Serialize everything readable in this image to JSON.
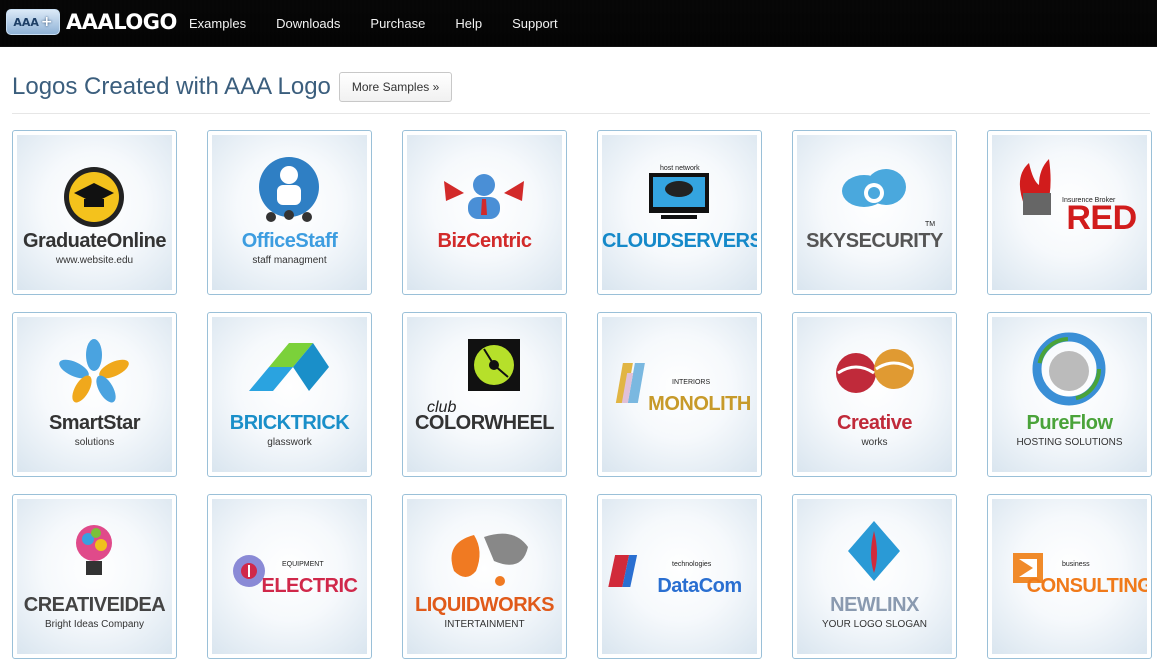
{
  "brand": {
    "badge": "AAA",
    "plus": "+",
    "name": "AAALOGO"
  },
  "nav": {
    "items": [
      "Examples",
      "Downloads",
      "Purchase",
      "Help",
      "Support"
    ]
  },
  "heading": {
    "title": "Logos Created with AAA Logo",
    "more_button": "More Samples »"
  },
  "logos": [
    {
      "name": "GraduateOnline",
      "sub": "www.website.edu",
      "tag": "",
      "color": "#333333",
      "accent": "#f4c21c",
      "icon": "graduation-cap-icon"
    },
    {
      "name": "OfficeStaff",
      "sub": "staff managment",
      "tag": "",
      "color": "#3d9de0",
      "accent": "#2f7fc4",
      "icon": "people-icon"
    },
    {
      "name": "BizCentric",
      "sub": "",
      "tag": "",
      "color": "#d22a2a",
      "accent": "#4a8fd6",
      "icon": "person-arrows-icon"
    },
    {
      "name": "CLOUDSERVERS",
      "sub": "",
      "tag": "host network",
      "color": "#1589c9",
      "accent": "#34a4e0",
      "icon": "monitor-cloud-icon"
    },
    {
      "name": "SKYSECURITY",
      "sub": "",
      "tag": "TM",
      "color": "#555555",
      "accent": "#4aa8dd",
      "icon": "cloud-lock-icon"
    },
    {
      "name": "RED",
      "sub": "",
      "tag": "Insurence Broker",
      "color": "#d11c1c",
      "accent": "#e64a1e",
      "icon": "flame-icon"
    },
    {
      "name": "SmartStar",
      "sub": "solutions",
      "tag": "",
      "color": "#333333",
      "accent": "#4aa3e0",
      "icon": "star-drops-icon"
    },
    {
      "name": "BRICKTRICK",
      "sub": "glasswork",
      "tag": "",
      "color": "#1a8fc9",
      "accent": "#7bd13a",
      "icon": "bricks-icon"
    },
    {
      "name": "COLORWHEEL",
      "sub": "",
      "tag": "club",
      "color": "#333333",
      "accent": "#b6e02a",
      "icon": "colorwheel-icon"
    },
    {
      "name": "MONOLITH",
      "sub": "",
      "tag": "INTERIORS",
      "color": "#c79a2a",
      "accent": "#e1b543",
      "icon": "monolith-icon"
    },
    {
      "name": "Creative",
      "sub": "works",
      "tag": "",
      "color": "#c02a3a",
      "accent": "#e09a32",
      "icon": "spheres-icon"
    },
    {
      "name": "PureFlow",
      "sub": "HOSTING SOLUTIONS",
      "tag": "",
      "color": "#4aa33a",
      "accent": "#3a8fd6",
      "icon": "ring-sphere-icon"
    },
    {
      "name": "CREATIVEIDEA",
      "sub": "Bright Ideas Company",
      "tag": "",
      "color": "#444444",
      "accent": "#e04a8a",
      "icon": "lightbulb-icon"
    },
    {
      "name": "ELECTRIC",
      "sub": "",
      "tag": "EQUIPMENT",
      "color": "#d0284a",
      "accent": "#8a8ad6",
      "icon": "electric-icon"
    },
    {
      "name": "LIQUIDWORKS",
      "sub": "INTERTAINMENT",
      "tag": "",
      "color": "#e05a1a",
      "accent": "#f07a22",
      "icon": "liquid-drop-icon"
    },
    {
      "name": "DataCom",
      "sub": "",
      "tag": "technologies",
      "color": "#2a6fd1",
      "accent": "#d12a3a",
      "icon": "datacom-icon"
    },
    {
      "name": "NEWLINX",
      "sub": "YOUR LOGO SLOGAN",
      "tag": "",
      "color": "#8a9ab0",
      "accent": "#2a9ad6",
      "icon": "diamond-drop-icon"
    },
    {
      "name": "CONSULTING",
      "sub": "",
      "tag": "business",
      "color": "#f07a1a",
      "accent": "#f08a2a",
      "icon": "square-frame-icon"
    }
  ]
}
